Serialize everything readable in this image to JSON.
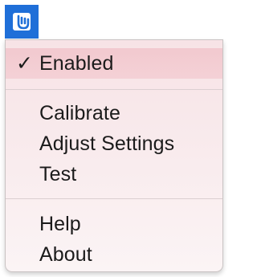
{
  "menubar": {
    "icon": "hand-pointer-icon",
    "accent_color": "#1f6fd8"
  },
  "menu": {
    "enabled": {
      "check": "✓",
      "label": "Enabled",
      "checked": true
    },
    "calibrate": {
      "label": "Calibrate"
    },
    "adjust_settings": {
      "label": "Adjust Settings"
    },
    "test": {
      "label": "Test"
    },
    "help": {
      "label": "Help"
    },
    "about": {
      "label": "About"
    }
  }
}
